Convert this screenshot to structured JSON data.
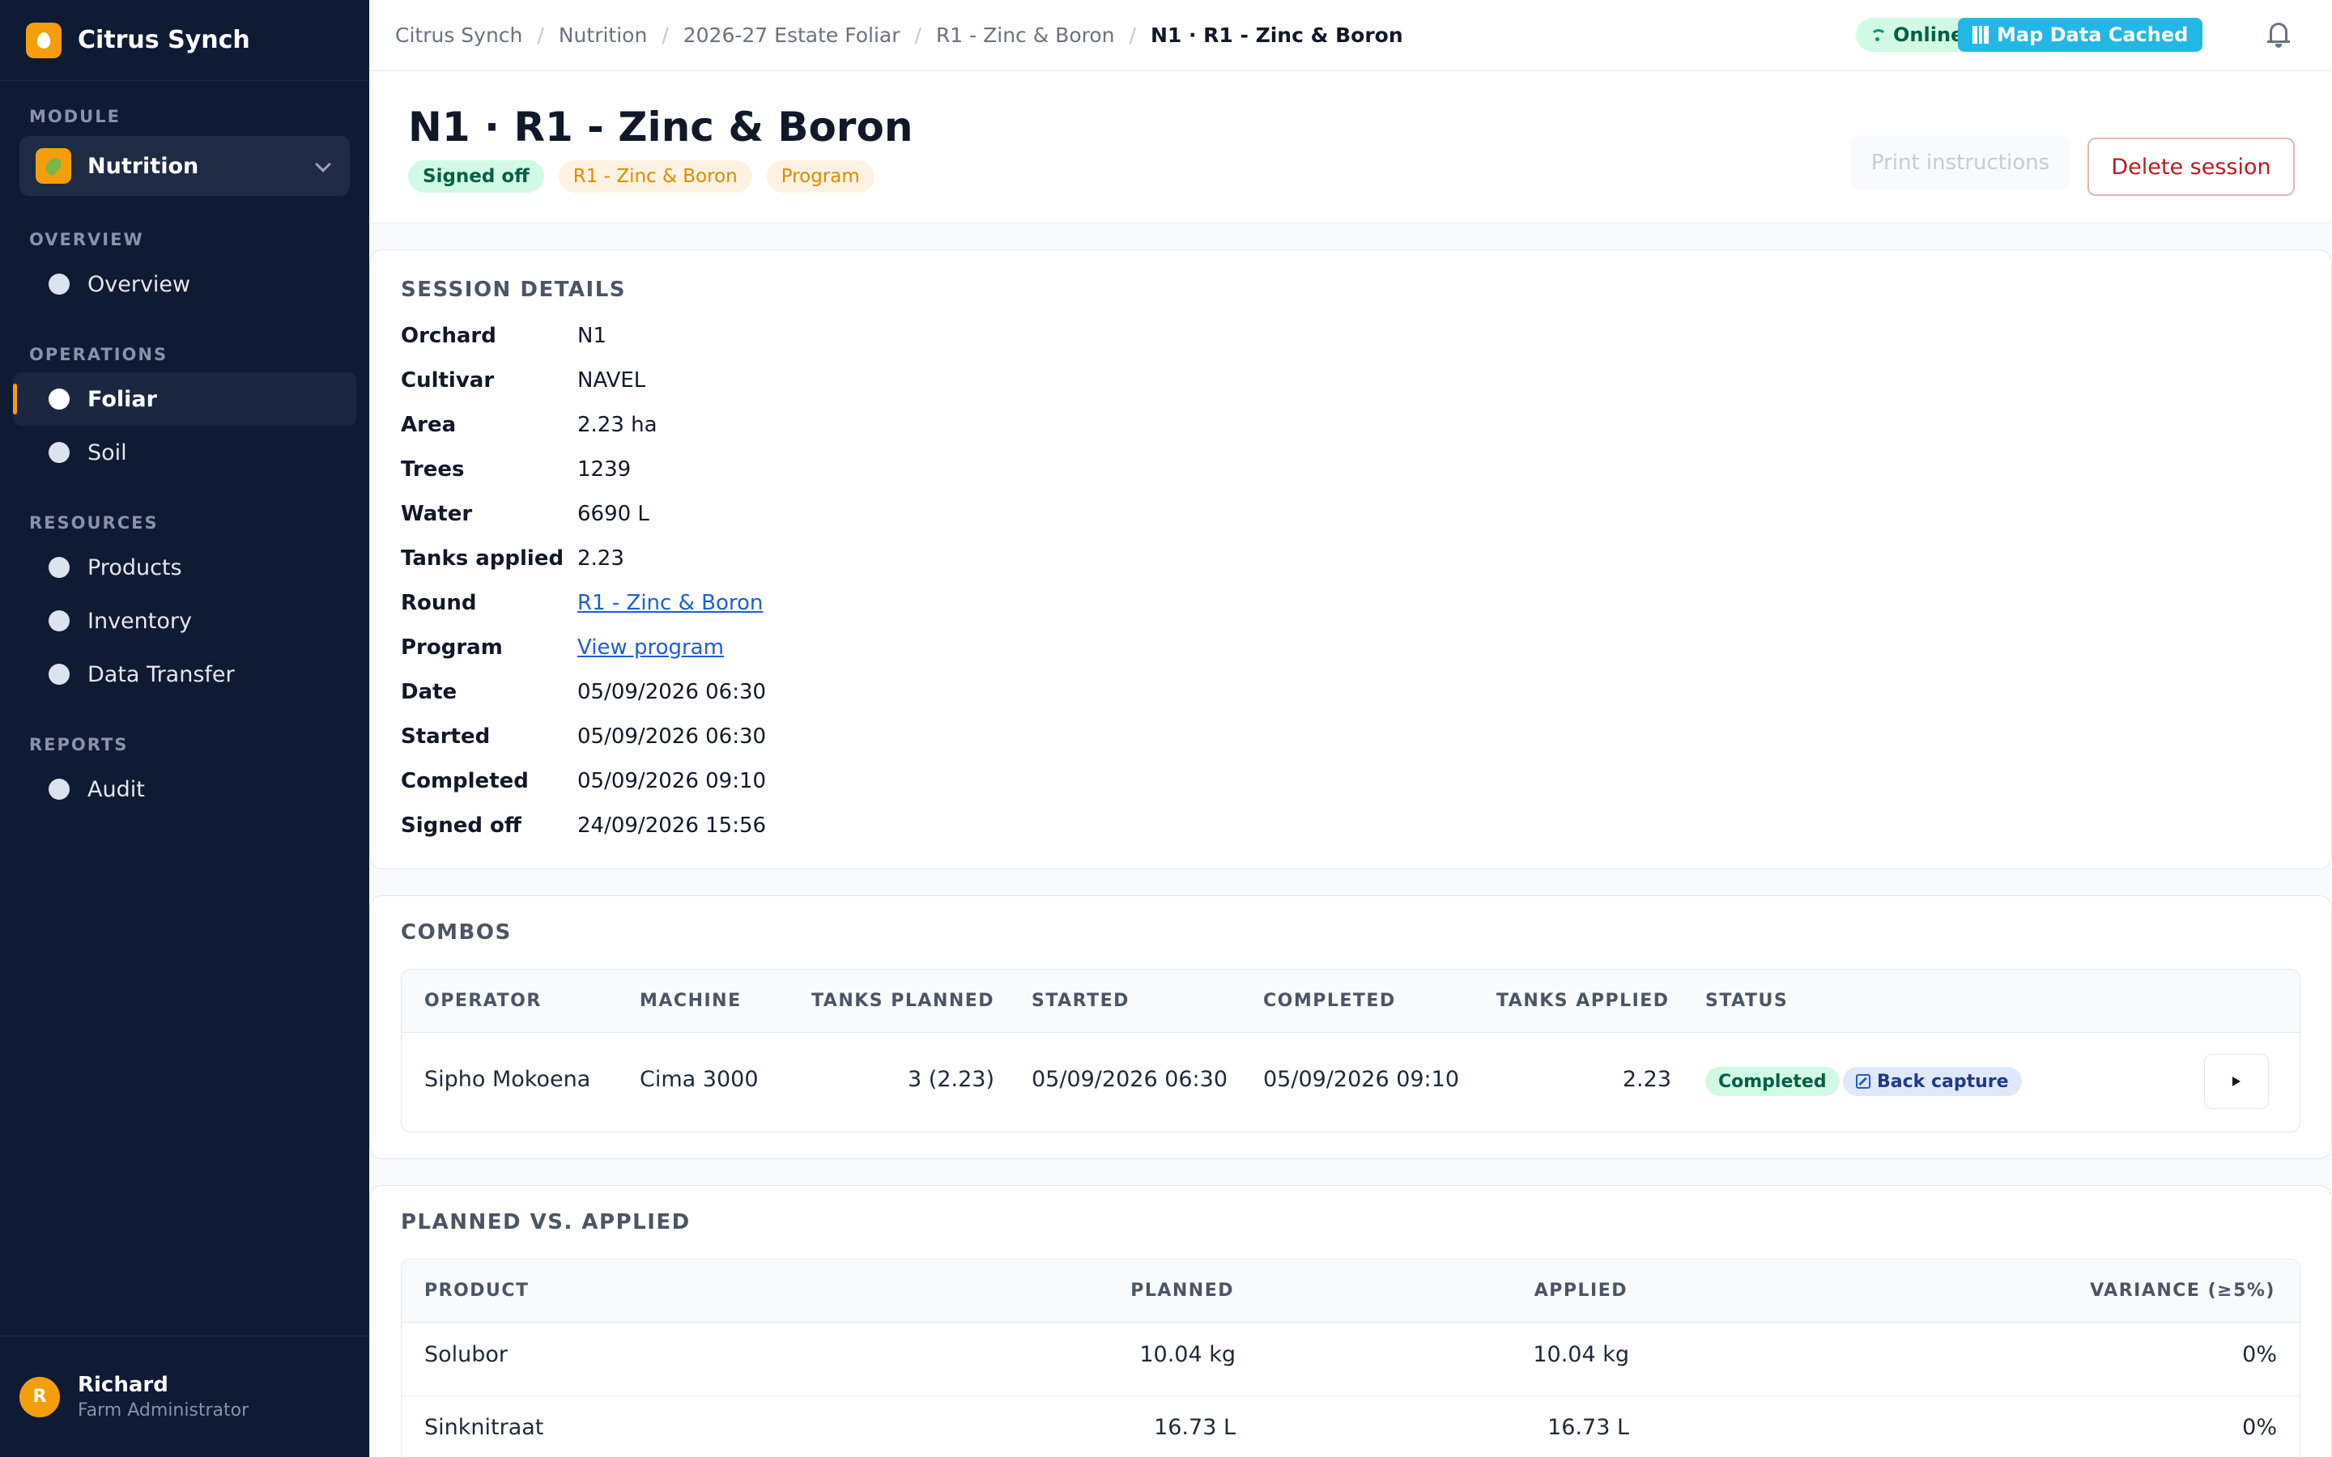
{
  "app": {
    "name": "Citrus Synch"
  },
  "sidebar": {
    "module_label": "MODULE",
    "module_name": "Nutrition",
    "sections": [
      {
        "label": "OVERVIEW",
        "items": [
          {
            "label": "Overview"
          }
        ]
      },
      {
        "label": "OPERATIONS",
        "items": [
          {
            "label": "Foliar",
            "active": true
          },
          {
            "label": "Soil"
          }
        ]
      },
      {
        "label": "RESOURCES",
        "items": [
          {
            "label": "Products"
          },
          {
            "label": "Inventory"
          },
          {
            "label": "Data Transfer"
          }
        ]
      },
      {
        "label": "REPORTS",
        "items": [
          {
            "label": "Audit"
          }
        ]
      }
    ],
    "user": {
      "initial": "R",
      "name": "Richard",
      "role": "Farm Administrator"
    }
  },
  "topbar": {
    "breadcrumbs": [
      "Citrus Synch",
      "Nutrition",
      "2026-27 Estate Foliar",
      "R1 - Zinc & Boron",
      "N1 · R1 - Zinc & Boron"
    ],
    "separator": "/",
    "online_label": "Online",
    "map_label": "Map Data Cached"
  },
  "header": {
    "title": "N1 · R1 - Zinc & Boron",
    "tags": [
      "Signed off",
      "R1 - Zinc & Boron",
      "Program"
    ],
    "print_label": "Print instructions",
    "delete_label": "Delete session"
  },
  "session_details": {
    "title": "SESSION DETAILS",
    "rows": [
      {
        "label": "Orchard",
        "value": "N1"
      },
      {
        "label": "Cultivar",
        "value": "NAVEL"
      },
      {
        "label": "Area",
        "value": "2.23 ha"
      },
      {
        "label": "Trees",
        "value": "1239"
      },
      {
        "label": "Water",
        "value": "6690 L"
      },
      {
        "label": "Tanks applied",
        "value": "2.23"
      },
      {
        "label": "Round",
        "value": "R1 - Zinc & Boron"
      },
      {
        "label": "Program",
        "value": "View program"
      },
      {
        "label": "Date",
        "value": "05/09/2026 06:30"
      },
      {
        "label": "Started",
        "value": "05/09/2026 06:30"
      },
      {
        "label": "Completed",
        "value": "05/09/2026 09:10"
      },
      {
        "label": "Signed off",
        "value": "24/09/2026 15:56"
      }
    ]
  },
  "combos": {
    "title": "COMBOS",
    "columns": [
      "OPERATOR",
      "MACHINE",
      "TANKS PLANNED",
      "STARTED",
      "COMPLETED",
      "TANKS APPLIED",
      "STATUS"
    ],
    "rows": [
      {
        "operator": "Sipho Mokoena",
        "machine": "Cima 3000",
        "tanks_planned": "3 (2.23)",
        "started": "05/09/2026 06:30",
        "completed": "05/09/2026 09:10",
        "tanks_applied": "2.23",
        "status": "Completed",
        "capture": "Back capture"
      }
    ]
  },
  "planned_vs_applied": {
    "title": "PLANNED VS. APPLIED",
    "columns": [
      "PRODUCT",
      "PLANNED",
      "APPLIED",
      "VARIANCE (≥5%)"
    ],
    "rows": [
      {
        "product": "Solubor",
        "planned": "10.04 kg",
        "applied": "10.04 kg",
        "variance": "0%"
      },
      {
        "product": "Sinknitraat",
        "planned": "16.73 L",
        "applied": "16.73 L",
        "variance": "0%"
      }
    ]
  },
  "colors": {
    "accent": "#f59e0b",
    "sidebar_bg": "#0f1a33",
    "link": "#1d5fd1",
    "danger": "#b91c1c",
    "success": "#065f46"
  }
}
